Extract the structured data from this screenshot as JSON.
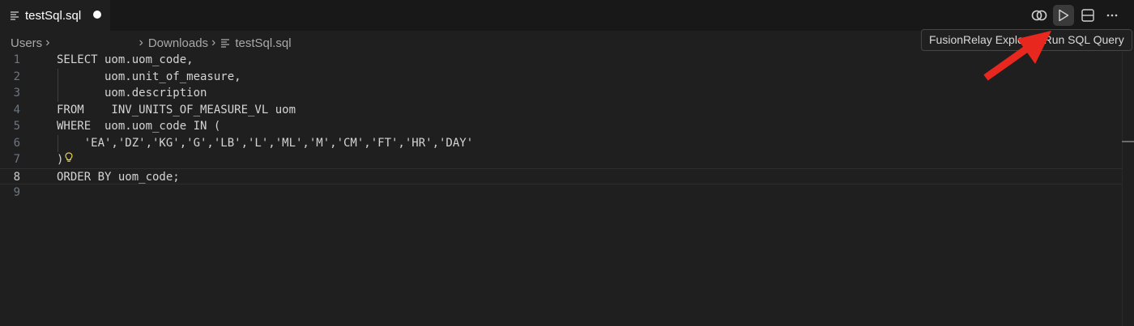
{
  "tab": {
    "title": "testSql.sql",
    "icon": "file-lines-icon",
    "dirty": true
  },
  "toolbar": {
    "items": [
      {
        "name": "compare-changes-button",
        "icon": "two-circles-icon"
      },
      {
        "name": "run-button",
        "icon": "play-icon"
      },
      {
        "name": "split-editor-button",
        "icon": "split-horizontal-icon"
      },
      {
        "name": "more-actions-button",
        "icon": "ellipsis-icon"
      }
    ]
  },
  "breadcrumb": {
    "root": "Users",
    "folder": "Downloads",
    "file": "testSql.sql"
  },
  "tooltip": {
    "text": "FusionRelay Explorer: Run SQL Query"
  },
  "editor": {
    "current_line": 8,
    "lines": [
      {
        "n": "1",
        "text": "SELECT uom.uom_code,"
      },
      {
        "n": "2",
        "text": "       uom.unit_of_measure,"
      },
      {
        "n": "3",
        "text": "       uom.description"
      },
      {
        "n": "4",
        "text": "FROM    INV_UNITS_OF_MEASURE_VL uom"
      },
      {
        "n": "5",
        "text": "WHERE  uom.uom_code IN ("
      },
      {
        "n": "6",
        "text": "    'EA','DZ','KG','G','LB','L','ML','M','CM','FT','HR','DAY'"
      },
      {
        "n": "7",
        "text": ")"
      },
      {
        "n": "8",
        "text": "ORDER BY uom_code;"
      },
      {
        "n": "9",
        "text": ""
      }
    ]
  },
  "colors": {
    "background": "#1f1f1f",
    "tabbar": "#181818",
    "annotation_arrow": "#e8281e",
    "lightbulb": "#e8d44d"
  }
}
